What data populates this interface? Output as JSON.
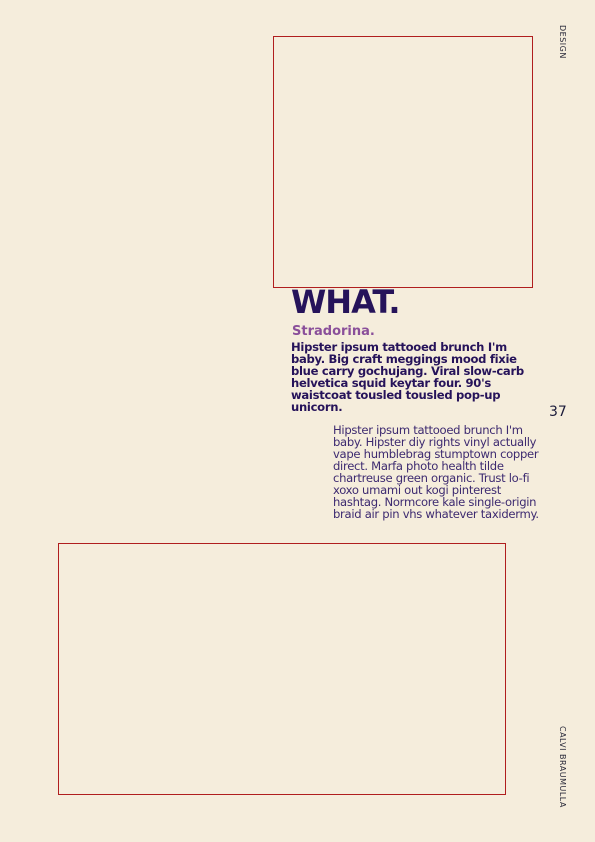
{
  "side_labels": {
    "top": "DESIGN",
    "bottom": "CALVI BRAUMULLA"
  },
  "page_number": "37",
  "article": {
    "heading": "WHAT.",
    "subheading": "Stradorina.",
    "lead": "Hipster ipsum tattooed brunch I'm baby. Big craft meggings mood fixie blue carry gochujang. Viral slow-carb helvetica squid keytar four. 90's waistcoat tousled tousled pop-up unicorn.",
    "body": "Hipster ipsum tattooed brunch I'm baby. Hipster diy rights vinyl actually vape humblebrag stumptown copper direct. Marfa photo health tilde chartreuse green organic. Trust lo-fi xoxo umami out kogi pinterest hashtag. Normcore kale single-origin braid air pin vhs whatever taxidermy."
  },
  "colors": {
    "background": "#f5eddc",
    "frame_border": "#b01e1e",
    "heading": "#26135a",
    "subheading": "#8a4f9a",
    "body_text": "#3d2a70"
  }
}
